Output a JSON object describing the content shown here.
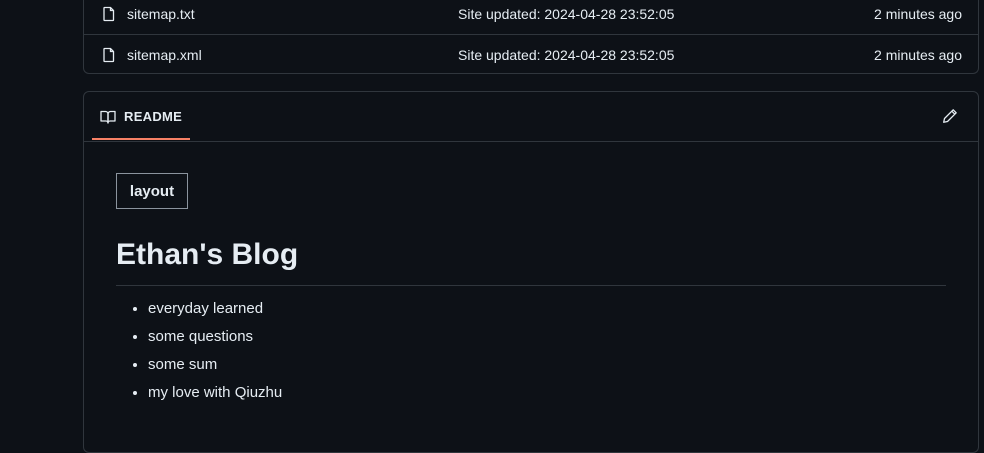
{
  "files": [
    {
      "name": "sitemap.txt",
      "commit_message": "Site updated: 2024-04-28 23:52:05",
      "age": "2 minutes ago",
      "icon": "file-icon"
    },
    {
      "name": "sitemap.xml",
      "commit_message": "Site updated: 2024-04-28 23:52:05",
      "age": "2 minutes ago",
      "icon": "file-icon"
    }
  ],
  "readme": {
    "tab_label": "README",
    "tab_icon": "book-icon",
    "edit_icon": "pencil-icon",
    "accent_color": "#f78166",
    "layout_tag": "layout",
    "title": "Ethan's Blog",
    "items": [
      "everyday learned",
      "some questions",
      "some sum",
      "my love with Qiuzhu"
    ]
  },
  "colors": {
    "background": "#0d1117",
    "border": "#30363d",
    "text": "#e6edf3"
  }
}
